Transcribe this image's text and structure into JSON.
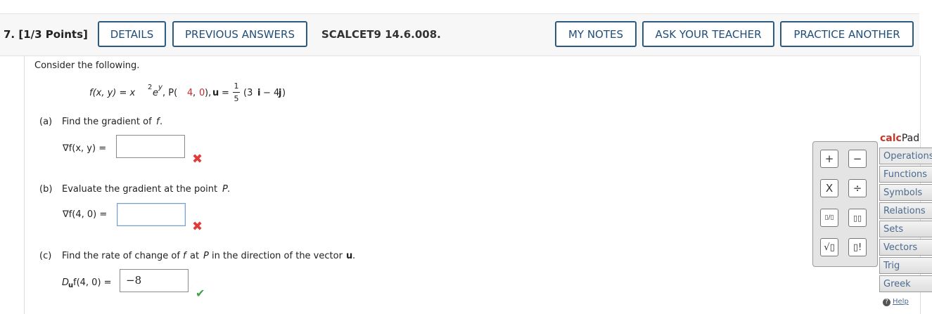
{
  "question": {
    "number_label": "7. [1/3 Points]",
    "buttons": {
      "details": "DETAILS",
      "previous_answers": "PREVIOUS ANSWERS",
      "my_notes": "MY NOTES",
      "ask_teacher": "ASK YOUR TEACHER",
      "practice": "PRACTICE ANOTHER"
    },
    "assignment_code": "SCALCET9 14.6.008."
  },
  "problem": {
    "intro": "Consider the following.",
    "func_lhs": "f(x, y) = x",
    "func_exp1": "2",
    "func_e": "e",
    "func_exp2": "y",
    "point_label": ", P(",
    "point_x": "4",
    "point_sep": ", ",
    "point_y": "0",
    "point_close": "),",
    "u_label": "u",
    "u_eq": "=",
    "frac_num": "1",
    "frac_den": "5",
    "vec_open": "(3",
    "vec_i": "i",
    "vec_minus": "− 4",
    "vec_j": "j",
    "vec_close": ")"
  },
  "parts": [
    {
      "label": "(a)",
      "prompt": "Find the gradient of",
      "prompt_var": "f",
      "prompt_end": ".",
      "lhs": "∇f(x, y) =",
      "value": "",
      "status": "incorrect"
    },
    {
      "label": "(b)",
      "prompt": "Evaluate the gradient at the point",
      "prompt_var": "P",
      "prompt_end": ".",
      "lhs": "∇f(4, 0) =",
      "value": "",
      "status": "incorrect"
    },
    {
      "label": "(c)",
      "prompt_a": "Find the rate of change of",
      "prompt_var1": "f",
      "prompt_b": "at",
      "prompt_var2": "P",
      "prompt_c": "in the direction of the vector",
      "prompt_vec": "u",
      "prompt_end": ".",
      "lhs_d": "D",
      "lhs_sub": "u",
      "lhs_rest": "f(4, 0) =",
      "value": "−8",
      "status": "correct"
    }
  ],
  "calcpad": {
    "title_a": "calc",
    "title_b": "Pad",
    "keys": [
      "+",
      "−",
      "X",
      "÷",
      "▯/▯",
      "▯▯",
      "√▯",
      "▯!"
    ],
    "tabs": [
      "Operations",
      "Functions",
      "Symbols",
      "Relations",
      "Sets",
      "Vectors",
      "Trig",
      "Greek"
    ],
    "help": "Help"
  },
  "colors": {
    "button_border": "#2d5a7e",
    "button_text": "#1f4e79",
    "incorrect": "#e03a3a",
    "correct": "#3aa346",
    "point_value": "#c02a2a",
    "tab_text": "#4b6b8e"
  }
}
